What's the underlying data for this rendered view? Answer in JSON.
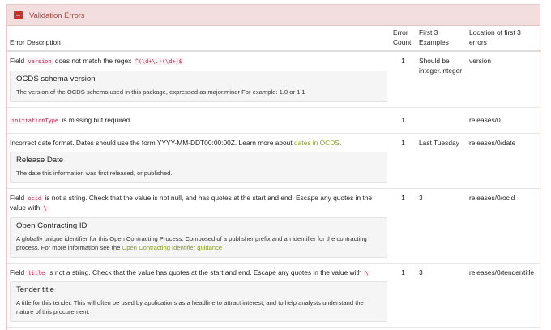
{
  "panel": {
    "title": "Validation Errors",
    "toggle_icon": "minus-square-icon",
    "accent_color": "#c9302c"
  },
  "table": {
    "headers": {
      "description": "Error Description",
      "count": "Error Count",
      "examples": "First 3 Examples",
      "location": "Location of first 3 errors"
    }
  },
  "rows": [
    {
      "msg_pre": "Field ",
      "msg_code": "version",
      "msg_mid": " does not match the regex ",
      "msg_code2": "^(\\d+\\.)(\\d+)$",
      "well_title": "OCDS schema version",
      "well_desc": "The version of the OCDS schema used in this package, expressed as major.minor For example: 1.0 or 1.1",
      "count": "1",
      "examples": "Should be integer.integer",
      "location": "version"
    },
    {
      "msg_code": "initiationType",
      "msg_post": " is missing but required",
      "count": "1",
      "examples": "",
      "location": "releases/0"
    },
    {
      "msg_pre": "Incorrect date format. Dates should use the form YYYY-MM-DDT00:00:00Z. Learn more about ",
      "msg_link": "dates in OCDS",
      "msg_post": ".",
      "well_title": "Release Date",
      "well_desc": "The date this information was first released, or published.",
      "count": "1",
      "examples": "Last Tuesday",
      "location": "releases/0/date"
    },
    {
      "msg_pre": "Field ",
      "msg_code": "ocid",
      "msg_mid": " is not a string. Check that the value is not null, and has quotes at the start and end. Escape any quotes in the value with ",
      "msg_code2": "\\",
      "well_title": "Open Contracting ID",
      "well_desc": "A globally unique identifier for this Open Contracting Process. Composed of a publisher prefix and an identifier for the contracting process. For more information see the ",
      "well_link": "Open Contracting Identifier guidance",
      "count": "1",
      "examples": "3",
      "location": "releases/0/ocid"
    },
    {
      "msg_pre": "Field ",
      "msg_code": "title",
      "msg_mid": " is not a string. Check that the value has quotes at the start and end. Escape any quotes in the value with ",
      "msg_code2": "\\",
      "well_title": "Tender title",
      "well_desc": "A title for this tender. This will often be used by applications as a headline to attract interest, and to help analysts understand the nature of this procurement.",
      "count": "1",
      "examples": "3",
      "location": "releases/0/tender/title"
    }
  ]
}
